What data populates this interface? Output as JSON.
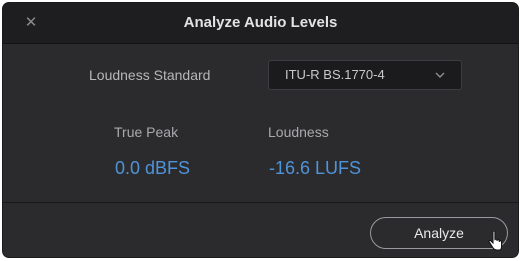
{
  "dialog": {
    "title": "Analyze Audio Levels",
    "close_icon": "close-icon"
  },
  "loudness_standard": {
    "label": "Loudness Standard",
    "selected": "ITU-R BS.1770-4",
    "dropdown_icon": "chevron-down-icon"
  },
  "measurements": {
    "true_peak": {
      "label": "True Peak",
      "value": "0.0 dBFS"
    },
    "loudness": {
      "label": "Loudness",
      "value": "-16.6 LUFS"
    }
  },
  "footer": {
    "analyze_label": "Analyze",
    "cursor_icon": "pointer-cursor-icon"
  },
  "colors": {
    "background": "#2b2b2e",
    "titlebar": "#1e1e20",
    "value_accent": "#4f93d8"
  }
}
